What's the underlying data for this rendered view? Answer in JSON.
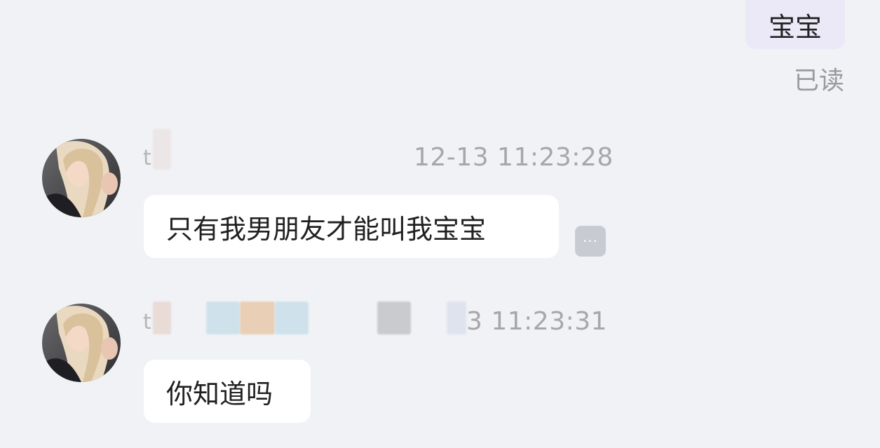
{
  "outgoing": {
    "text": "宝宝",
    "status": "已读"
  },
  "messages": [
    {
      "sender_initial": "t",
      "timestamp": "12-13 11:23:28",
      "text": "只有我男朋友才能叫我宝宝",
      "more_icon": "ellipsis-icon",
      "more_label": "···"
    },
    {
      "sender_initial": "t",
      "timestamp": "3 11:23:31",
      "text": "你知道吗"
    }
  ],
  "colors": {
    "background": "#f1f2f6",
    "outgoing_bubble": "#ebe9f8",
    "incoming_bubble": "#ffffff",
    "timestamp": "#a7a7ab"
  }
}
